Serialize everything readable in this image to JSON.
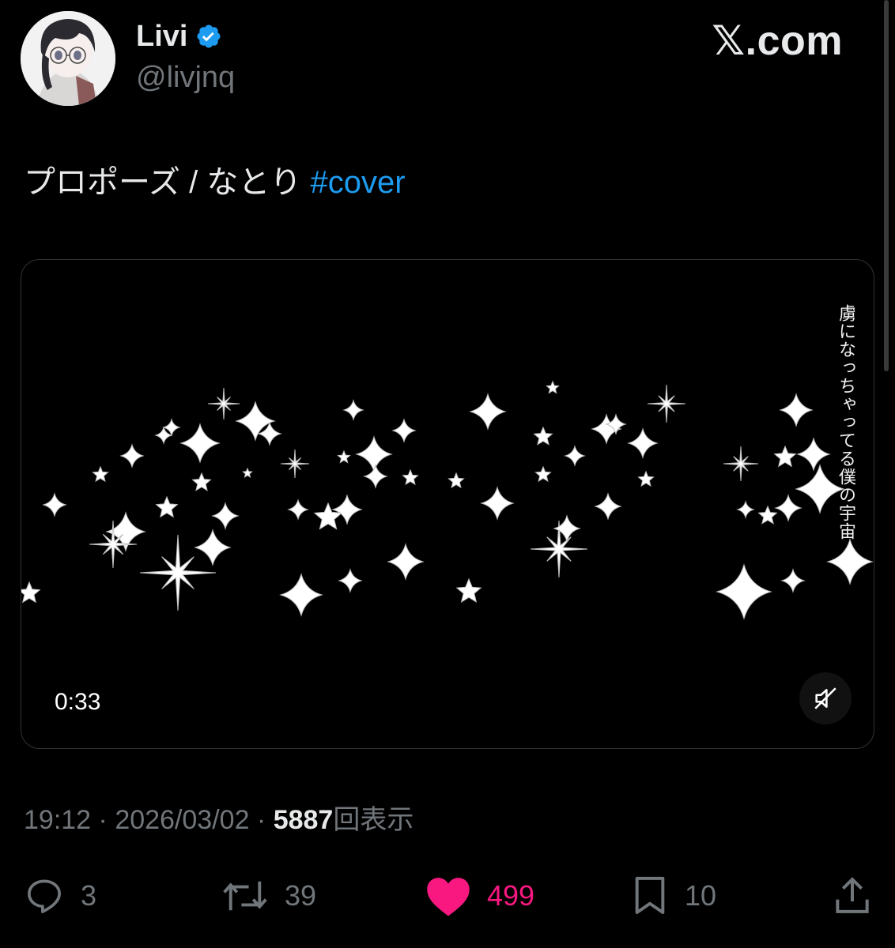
{
  "author": {
    "display_name": "Livi",
    "handle": "@livjnq",
    "verified": true,
    "verified_color": "#1d9bf0",
    "avatar_icon": "anime-portrait-avatar"
  },
  "site_label": "𝕏.com",
  "tweet": {
    "text": "プロポーズ / なとり ",
    "hashtag": "#cover",
    "hashtag_color": "#1d9bf0"
  },
  "media": {
    "type": "video",
    "vertical_caption": "虜になっちゃってる僕の宇宙",
    "duration": "0:33",
    "muted": true
  },
  "meta": {
    "time": "19:12",
    "separator": " · ",
    "date": "2026/03/02",
    "views_count": "5887",
    "views_label": "回表示"
  },
  "actions": {
    "replies": "3",
    "reposts": "39",
    "likes": "499",
    "liked": true,
    "like_color": "#f91880",
    "bookmarks": "10"
  }
}
